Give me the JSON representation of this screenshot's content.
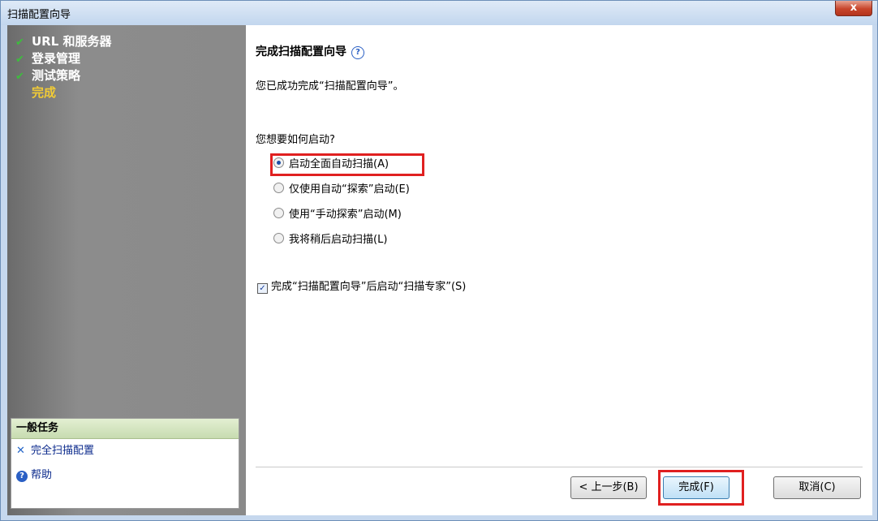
{
  "window": {
    "title": "扫描配置向导",
    "close_glyph": "x"
  },
  "steps": [
    {
      "label": "URL 和服务器",
      "done": true
    },
    {
      "label": "登录管理",
      "done": true
    },
    {
      "label": "测试策略",
      "done": true
    },
    {
      "label": "完成",
      "done": false
    }
  ],
  "check_glyph": "✔",
  "tasks": {
    "header": "一般任务",
    "items": [
      {
        "label": "完全扫描配置",
        "icon": "tools-icon"
      },
      {
        "label": "帮助",
        "icon": "help-icon"
      }
    ]
  },
  "main": {
    "heading": "完成扫描配置向导",
    "help_glyph": "?",
    "completed_text": "您已成功完成“扫描配置向导”。",
    "question": "您想要如何启动?",
    "options": [
      {
        "label": "启动全面自动扫描(A)",
        "selected": true
      },
      {
        "label": "仅使用自动“探索”启动(E)",
        "selected": false
      },
      {
        "label": "使用“手动探索”启动(M)",
        "selected": false
      },
      {
        "label": "我将稍后启动扫描(L)",
        "selected": false
      }
    ],
    "checkbox": {
      "label": "完成“扫描配置向导”后启动“扫描专家”(S)",
      "checked": true,
      "glyph": "✓"
    }
  },
  "buttons": {
    "back": "< 上一步(B)",
    "finish": "完成(F)",
    "cancel": "取消(C)"
  },
  "colors": {
    "highlight": "#e02020",
    "current_step": "#f1cb36",
    "check": "#3dbd3d",
    "link": "#0b2a8c"
  }
}
